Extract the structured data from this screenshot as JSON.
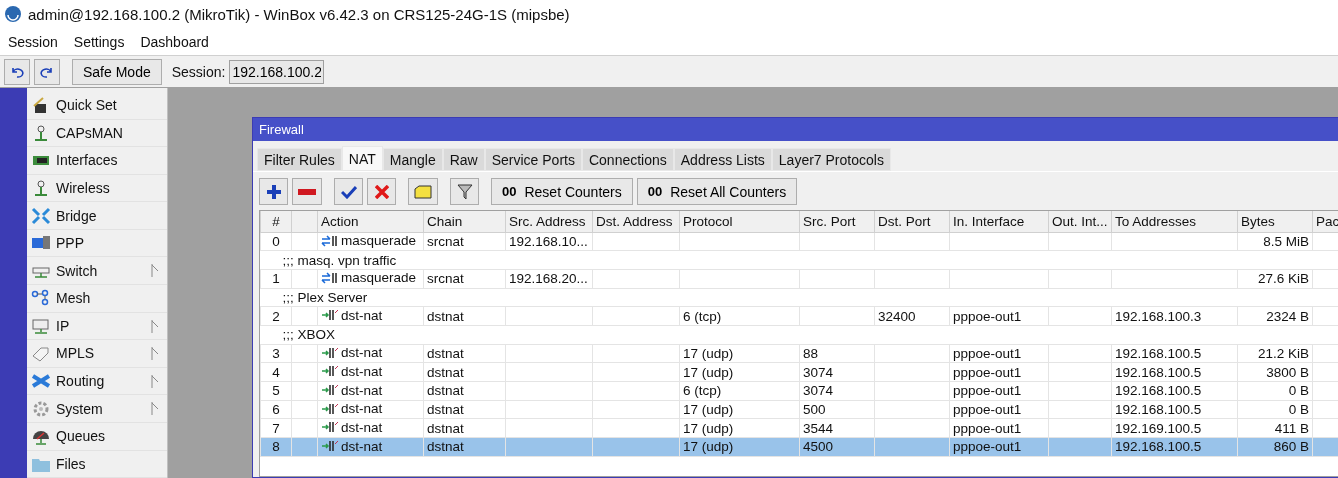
{
  "window": {
    "title": "admin@192.168.100.2 (MikroTik) - WinBox v6.42.3 on CRS125-24G-1S (mipsbe)"
  },
  "menu": [
    "Session",
    "Settings",
    "Dashboard"
  ],
  "toolbar": {
    "safe_mode": "Safe Mode",
    "session_label": "Session:",
    "session_value": "192.168.100.2"
  },
  "sidebar": {
    "items": [
      {
        "label": "Quick Set",
        "submenu": false
      },
      {
        "label": "CAPsMAN",
        "submenu": false
      },
      {
        "label": "Interfaces",
        "submenu": false
      },
      {
        "label": "Wireless",
        "submenu": false
      },
      {
        "label": "Bridge",
        "submenu": false
      },
      {
        "label": "PPP",
        "submenu": false
      },
      {
        "label": "Switch",
        "submenu": true
      },
      {
        "label": "Mesh",
        "submenu": false
      },
      {
        "label": "IP",
        "submenu": true
      },
      {
        "label": "MPLS",
        "submenu": true
      },
      {
        "label": "Routing",
        "submenu": true
      },
      {
        "label": "System",
        "submenu": true
      },
      {
        "label": "Queues",
        "submenu": false
      },
      {
        "label": "Files",
        "submenu": false
      }
    ]
  },
  "firewall": {
    "title": "Firewall",
    "tabs": [
      {
        "label": "Filter Rules",
        "selected": false
      },
      {
        "label": "NAT",
        "selected": true
      },
      {
        "label": "Mangle",
        "selected": false
      },
      {
        "label": "Raw",
        "selected": false
      },
      {
        "label": "Service Ports",
        "selected": false
      },
      {
        "label": "Connections",
        "selected": false
      },
      {
        "label": "Address Lists",
        "selected": false
      },
      {
        "label": "Layer7 Protocols",
        "selected": false
      }
    ],
    "buttons": [
      {
        "kind": "add"
      },
      {
        "kind": "remove"
      },
      {
        "kind": "enable"
      },
      {
        "kind": "disable"
      },
      {
        "kind": "comment"
      },
      {
        "kind": "filter"
      },
      {
        "kind": "text",
        "icon_text": "00",
        "label": "Reset Counters"
      },
      {
        "kind": "text",
        "icon_text": "00",
        "label": "Reset All Counters"
      }
    ],
    "table": {
      "columns": [
        "#",
        "",
        "Action",
        "Chain",
        "Src. Address",
        "Dst. Address",
        "Protocol",
        "Src. Port",
        "Dst. Port",
        "In. Interface",
        "Out. Int...",
        "To Addresses",
        "Bytes",
        "Pac"
      ],
      "rows": [
        {
          "kind": "rule",
          "selected": false,
          "cells": [
            "0",
            "",
            {
              "kind": "masquerade",
              "label": "masquerade"
            },
            "srcnat",
            "192.168.10...",
            "",
            "",
            "",
            "",
            "",
            "",
            "",
            "8.5 MiB",
            ""
          ]
        },
        {
          "kind": "comment",
          "selected": false,
          "text": ";;; masq. vpn traffic"
        },
        {
          "kind": "rule",
          "selected": false,
          "cells": [
            "1",
            "",
            {
              "kind": "masquerade",
              "label": "masquerade"
            },
            "srcnat",
            "192.168.20...",
            "",
            "",
            "",
            "",
            "",
            "",
            "",
            "27.6 KiB",
            ""
          ]
        },
        {
          "kind": "comment",
          "selected": false,
          "text": ";;; Plex Server"
        },
        {
          "kind": "rule",
          "selected": false,
          "cells": [
            "2",
            "",
            {
              "kind": "dst-nat",
              "label": "dst-nat"
            },
            "dstnat",
            "",
            "",
            "6 (tcp)",
            "",
            "32400",
            "pppoe-out1",
            "",
            "192.168.100.3",
            "2324 B",
            ""
          ]
        },
        {
          "kind": "comment",
          "selected": false,
          "text": ";;; XBOX"
        },
        {
          "kind": "rule",
          "selected": false,
          "cells": [
            "3",
            "",
            {
              "kind": "dst-nat",
              "label": "dst-nat"
            },
            "dstnat",
            "",
            "",
            "17 (udp)",
            "88",
            "",
            "pppoe-out1",
            "",
            "192.168.100.5",
            "21.2 KiB",
            ""
          ]
        },
        {
          "kind": "rule",
          "selected": false,
          "cells": [
            "4",
            "",
            {
              "kind": "dst-nat",
              "label": "dst-nat"
            },
            "dstnat",
            "",
            "",
            "17 (udp)",
            "3074",
            "",
            "pppoe-out1",
            "",
            "192.168.100.5",
            "3800 B",
            ""
          ]
        },
        {
          "kind": "rule",
          "selected": false,
          "cells": [
            "5",
            "",
            {
              "kind": "dst-nat",
              "label": "dst-nat"
            },
            "dstnat",
            "",
            "",
            "6 (tcp)",
            "3074",
            "",
            "pppoe-out1",
            "",
            "192.168.100.5",
            "0 B",
            ""
          ]
        },
        {
          "kind": "rule",
          "selected": false,
          "cells": [
            "6",
            "",
            {
              "kind": "dst-nat",
              "label": "dst-nat"
            },
            "dstnat",
            "",
            "",
            "17 (udp)",
            "500",
            "",
            "pppoe-out1",
            "",
            "192.168.100.5",
            "0 B",
            ""
          ]
        },
        {
          "kind": "rule",
          "selected": false,
          "cells": [
            "7",
            "",
            {
              "kind": "dst-nat",
              "label": "dst-nat"
            },
            "dstnat",
            "",
            "",
            "17 (udp)",
            "3544",
            "",
            "pppoe-out1",
            "",
            "192.169.100.5",
            "411 B",
            ""
          ]
        },
        {
          "kind": "rule",
          "selected": true,
          "cells": [
            "8",
            "",
            {
              "kind": "dst-nat",
              "label": "dst-nat"
            },
            "dstnat",
            "",
            "",
            "17 (udp)",
            "4500",
            "",
            "pppoe-out1",
            "",
            "192.168.100.5",
            "860 B",
            ""
          ]
        }
      ]
    }
  }
}
